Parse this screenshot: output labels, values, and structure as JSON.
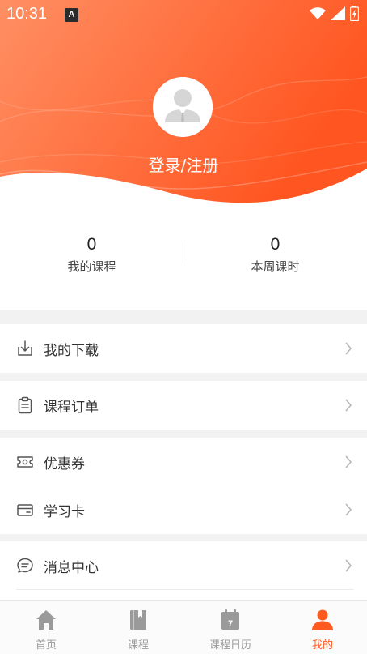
{
  "status_bar": {
    "time": "10:31",
    "notification_badge": "A"
  },
  "profile": {
    "login_label": "登录/注册"
  },
  "stats": [
    {
      "value": "0",
      "label": "我的课程"
    },
    {
      "value": "0",
      "label": "本周课时"
    }
  ],
  "menu": {
    "downloads": "我的下载",
    "orders": "课程订单",
    "coupons": "优惠券",
    "study_card": "学习卡",
    "messages": "消息中心"
  },
  "tabs": [
    {
      "label": "首页",
      "icon": "home-icon"
    },
    {
      "label": "课程",
      "icon": "book-icon"
    },
    {
      "label": "课程日历",
      "icon": "calendar-icon",
      "badge": "7"
    },
    {
      "label": "我的",
      "icon": "person-icon",
      "active": true
    }
  ],
  "colors": {
    "accent": "#ff5a1f",
    "header_start": "#ff8a5c",
    "header_end": "#ff5522",
    "muted": "#9a9a9a"
  }
}
